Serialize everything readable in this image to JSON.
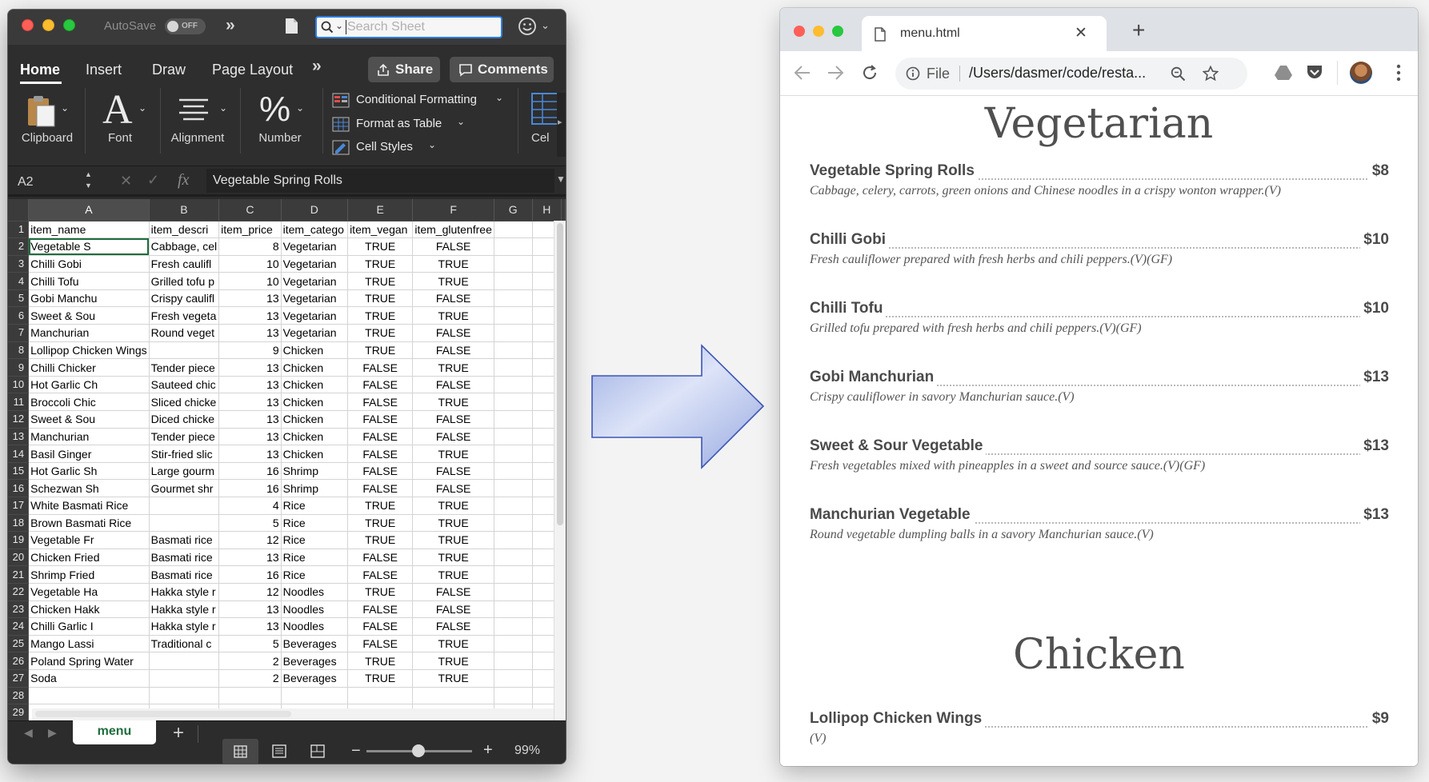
{
  "excel": {
    "autosave_label": "AutoSave",
    "autosave_state": "OFF",
    "search_placeholder": "Search Sheet",
    "ribbon_tabs": [
      "Home",
      "Insert",
      "Draw",
      "Page Layout"
    ],
    "share_label": "Share",
    "comments_label": "Comments",
    "groups": {
      "clipboard": "Clipboard",
      "font": "Font",
      "alignment": "Alignment",
      "number": "Number",
      "cells": "Cel"
    },
    "commands": {
      "conditional_formatting": "Conditional Formatting",
      "format_as_table": "Format as Table",
      "cell_styles": "Cell Styles"
    },
    "name_box": "A2",
    "formula_fx": "fx",
    "formula_value": "Vegetable Spring Rolls",
    "column_headers": [
      "A",
      "B",
      "C",
      "D",
      "E",
      "F",
      "G",
      "H"
    ],
    "row_numbers": [
      "1",
      "2",
      "3",
      "4",
      "5",
      "6",
      "7",
      "8",
      "9",
      "10",
      "11",
      "12",
      "13",
      "14",
      "15",
      "16",
      "17",
      "18",
      "19",
      "20",
      "21",
      "22",
      "23",
      "24",
      "25",
      "26",
      "27",
      "28",
      "29"
    ],
    "rows": [
      [
        "item_name",
        "item_descri",
        "item_price",
        "item_catego",
        "item_vegan",
        "item_glutenfree",
        "",
        ""
      ],
      [
        "Vegetable S",
        "Cabbage, cel",
        "8",
        "Vegetarian",
        "TRUE",
        "FALSE",
        "",
        ""
      ],
      [
        "Chilli Gobi",
        "Fresh caulifl",
        "10",
        "Vegetarian",
        "TRUE",
        "TRUE",
        "",
        ""
      ],
      [
        "Chilli Tofu",
        "Grilled tofu p",
        "10",
        "Vegetarian",
        "TRUE",
        "TRUE",
        "",
        ""
      ],
      [
        "Gobi Manchu",
        "Crispy caulifl",
        "13",
        "Vegetarian",
        "TRUE",
        "FALSE",
        "",
        ""
      ],
      [
        "Sweet & Sou",
        "Fresh vegeta",
        "13",
        "Vegetarian",
        "TRUE",
        "TRUE",
        "",
        ""
      ],
      [
        "Manchurian",
        "Round veget",
        "13",
        "Vegetarian",
        "TRUE",
        "FALSE",
        "",
        ""
      ],
      [
        "Lollipop Chicken Wings",
        "",
        "9",
        "Chicken",
        "TRUE",
        "FALSE",
        "",
        ""
      ],
      [
        "Chilli Chicker",
        "Tender piece",
        "13",
        "Chicken",
        "FALSE",
        "TRUE",
        "",
        ""
      ],
      [
        "Hot Garlic Ch",
        "Sauteed chic",
        "13",
        "Chicken",
        "FALSE",
        "FALSE",
        "",
        ""
      ],
      [
        "Broccoli Chic",
        "Sliced chicke",
        "13",
        "Chicken",
        "FALSE",
        "TRUE",
        "",
        ""
      ],
      [
        "Sweet & Sou",
        "Diced chicke",
        "13",
        "Chicken",
        "FALSE",
        "FALSE",
        "",
        ""
      ],
      [
        "Manchurian",
        "Tender piece",
        "13",
        "Chicken",
        "FALSE",
        "FALSE",
        "",
        ""
      ],
      [
        "Basil Ginger",
        "Stir-fried slic",
        "13",
        "Chicken",
        "FALSE",
        "TRUE",
        "",
        ""
      ],
      [
        "Hot Garlic Sh",
        "Large gourm",
        "16",
        "Shrimp",
        "FALSE",
        "FALSE",
        "",
        ""
      ],
      [
        "Schezwan Sh",
        "Gourmet shr",
        "16",
        "Shrimp",
        "FALSE",
        "FALSE",
        "",
        ""
      ],
      [
        "White Basmati Rice",
        "",
        "4",
        "Rice",
        "TRUE",
        "TRUE",
        "",
        ""
      ],
      [
        "Brown Basmati Rice",
        "",
        "5",
        "Rice",
        "TRUE",
        "TRUE",
        "",
        ""
      ],
      [
        "Vegetable Fr",
        "Basmati rice",
        "12",
        "Rice",
        "TRUE",
        "TRUE",
        "",
        ""
      ],
      [
        "Chicken Fried",
        "Basmati rice",
        "13",
        "Rice",
        "FALSE",
        "TRUE",
        "",
        ""
      ],
      [
        "Shrimp Fried",
        "Basmati rice",
        "16",
        "Rice",
        "FALSE",
        "TRUE",
        "",
        ""
      ],
      [
        "Vegetable Ha",
        "Hakka style r",
        "12",
        "Noodles",
        "TRUE",
        "FALSE",
        "",
        ""
      ],
      [
        "Chicken Hakk",
        "Hakka style r",
        "13",
        "Noodles",
        "FALSE",
        "FALSE",
        "",
        ""
      ],
      [
        "Chilli Garlic I",
        "Hakka style r",
        "13",
        "Noodles",
        "FALSE",
        "FALSE",
        "",
        ""
      ],
      [
        "Mango Lassi",
        "Traditional c",
        "5",
        "Beverages",
        "FALSE",
        "TRUE",
        "",
        ""
      ],
      [
        "Poland Spring Water",
        "",
        "2",
        "Beverages",
        "TRUE",
        "TRUE",
        "",
        ""
      ],
      [
        "Soda",
        "",
        "2",
        "Beverages",
        "TRUE",
        "TRUE",
        "",
        ""
      ],
      [
        "",
        "",
        "",
        "",
        "",
        "",
        "",
        ""
      ],
      [
        "",
        "",
        "",
        "",
        "",
        "",
        "",
        ""
      ]
    ],
    "sheet_tab": "menu",
    "zoom": "99%",
    "colors": {
      "accent_green": "#1e6d3c",
      "search_border": "#2f7de1"
    }
  },
  "browser": {
    "tab_title": "menu.html",
    "url_scheme_label": "File",
    "url": "/Users/dasmer/code/resta...",
    "sections": [
      {
        "title": "Vegetarian",
        "items": [
          {
            "name": "Vegetable Spring Rolls",
            "price": "$8",
            "desc": "Cabbage, celery, carrots, green onions and Chinese noodles in a crispy wonton wrapper.(V)"
          },
          {
            "name": "Chilli Gobi",
            "price": "$10",
            "desc": "Fresh cauliflower prepared with fresh herbs and chili peppers.(V)(GF)"
          },
          {
            "name": "Chilli Tofu",
            "price": "$10",
            "desc": "Grilled tofu prepared with fresh herbs and chili peppers.(V)(GF)"
          },
          {
            "name": "Gobi Manchurian",
            "price": "$13",
            "desc": "Crispy cauliflower in savory Manchurian sauce.(V)"
          },
          {
            "name": "Sweet & Sour Vegetable",
            "price": "$13",
            "desc": "Fresh vegetables mixed with pineapples in a sweet and source sauce.(V)(GF)"
          },
          {
            "name": "Manchurian Vegetable",
            "price": "$13",
            "desc": "Round vegetable dumpling balls in a savory Manchurian sauce.(V)"
          }
        ]
      },
      {
        "title": "Chicken",
        "items": [
          {
            "name": "Lollipop Chicken Wings",
            "price": "$9",
            "desc": "(V)"
          }
        ]
      }
    ]
  }
}
